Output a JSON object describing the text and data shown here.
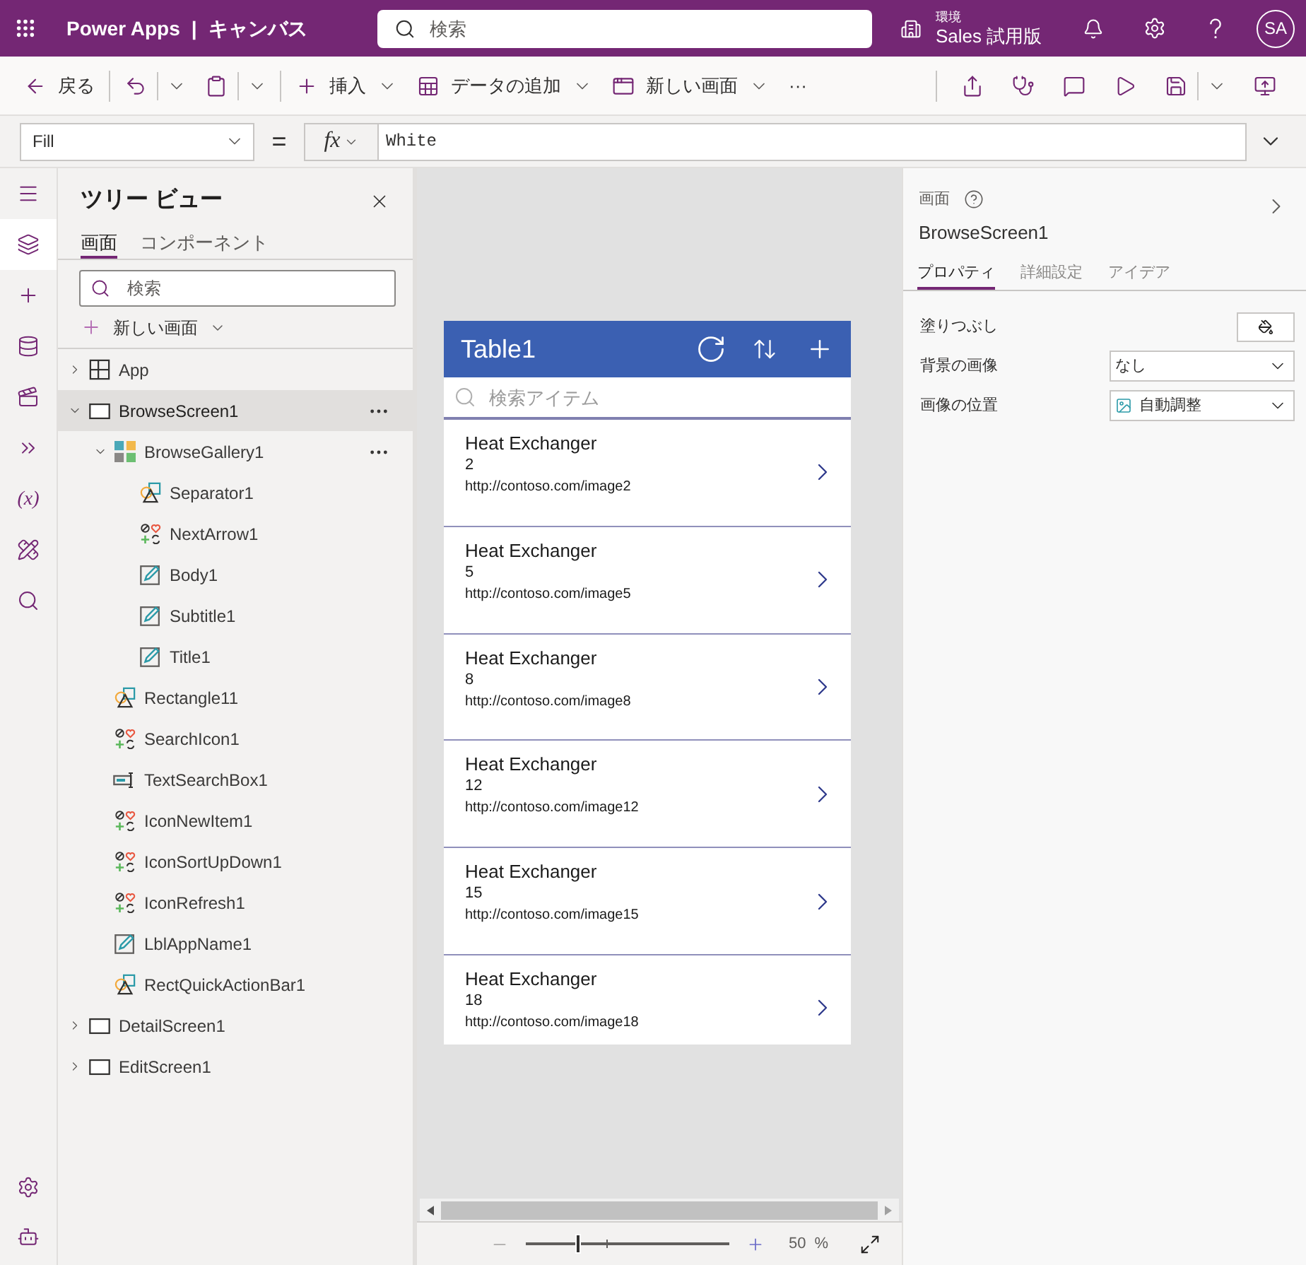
{
  "top_bar": {
    "title": "Power Apps",
    "separator": "|",
    "subtitle": "キャンバス",
    "search": {
      "placeholder": "検索"
    },
    "environment": {
      "label": "環境",
      "name": "Sales 試用版"
    },
    "avatar": "SA"
  },
  "toolbar": {
    "left": [
      [
        {
          "kind": "back",
          "label": "戻る"
        }
      ],
      [
        {
          "kind": "undo",
          "split": true
        },
        {
          "kind": "paste",
          "split": true
        }
      ],
      [
        {
          "kind": "insert",
          "label": "挿入",
          "caret": true
        },
        {
          "kind": "add_data",
          "label": "データの追加",
          "caret": true
        },
        {
          "kind": "new_screen",
          "label": "新しい画面",
          "caret": true
        },
        {
          "kind": "more",
          "label": "···"
        }
      ]
    ],
    "right": [
      {
        "kind": "share"
      },
      {
        "kind": "checker"
      },
      {
        "kind": "comments"
      },
      {
        "kind": "preview"
      },
      {
        "kind": "save",
        "split": true
      },
      {
        "kind": "publish"
      }
    ]
  },
  "formula_bar": {
    "property": "Fill",
    "operator": "=",
    "fx": "fx",
    "formula": "White"
  },
  "left_rail": {
    "items": [
      {
        "kind": "menu",
        "selected": false
      },
      {
        "kind": "tree",
        "selected": true
      },
      {
        "kind": "insert",
        "selected": false
      },
      {
        "kind": "data",
        "selected": false
      },
      {
        "kind": "media",
        "selected": false
      },
      {
        "kind": "automate",
        "selected": false
      },
      {
        "kind": "variables",
        "glyph": "(x)",
        "selected": false
      },
      {
        "kind": "tools",
        "selected": false
      },
      {
        "kind": "search",
        "selected": false
      }
    ],
    "bottom": [
      {
        "kind": "settings"
      },
      {
        "kind": "agent"
      }
    ]
  },
  "tree_view": {
    "title": "ツリー ビュー",
    "tabs": [
      {
        "label": "画面",
        "selected": true
      },
      {
        "label": "コンポーネント",
        "selected": false
      }
    ],
    "search": {
      "placeholder": "検索"
    },
    "new_screen": {
      "label": "新しい画面"
    },
    "items": [
      {
        "kind": "app",
        "label": "App",
        "expanded": false,
        "selected": false
      },
      {
        "kind": "screen",
        "label": "BrowseScreen1",
        "expanded": true,
        "selected": true,
        "more_button": true,
        "children": [
          {
            "kind": "gallery",
            "label": "BrowseGallery1",
            "expanded": true,
            "selected": false,
            "more_button": true,
            "children": [
              {
                "kind": "shape",
                "label": "Separator1",
                "selected": false
              },
              {
                "kind": "icon",
                "label": "NextArrow1",
                "selected": false
              },
              {
                "kind": "label",
                "label": "Body1",
                "selected": false
              },
              {
                "kind": "label",
                "label": "Subtitle1",
                "selected": false
              },
              {
                "kind": "label",
                "label": "Title1",
                "selected": false
              }
            ]
          },
          {
            "kind": "shape",
            "label": "Rectangle11",
            "selected": false
          },
          {
            "kind": "icon",
            "label": "SearchIcon1",
            "selected": false
          },
          {
            "kind": "textinput",
            "label": "TextSearchBox1",
            "selected": false
          },
          {
            "kind": "icon",
            "label": "IconNewItem1",
            "selected": false
          },
          {
            "kind": "icon",
            "label": "IconSortUpDown1",
            "selected": false
          },
          {
            "kind": "icon",
            "label": "IconRefresh1",
            "selected": false
          },
          {
            "kind": "label",
            "label": "LblAppName1",
            "selected": false
          },
          {
            "kind": "shape",
            "label": "RectQuickActionBar1",
            "selected": false
          }
        ]
      },
      {
        "kind": "screen",
        "label": "DetailScreen1",
        "expanded": false,
        "selected": false
      },
      {
        "kind": "screen",
        "label": "EditScreen1",
        "expanded": false,
        "selected": false
      }
    ]
  },
  "canvas": {
    "app": {
      "title": "Table1",
      "search": {
        "placeholder": "検索アイテム"
      },
      "items": [
        {
          "title": "Heat Exchanger",
          "number": "2",
          "url": "http://contoso.com/image2"
        },
        {
          "title": "Heat Exchanger",
          "number": "5",
          "url": "http://contoso.com/image5"
        },
        {
          "title": "Heat Exchanger",
          "number": "8",
          "url": "http://contoso.com/image8"
        },
        {
          "title": "Heat Exchanger",
          "number": "12",
          "url": "http://contoso.com/image12"
        },
        {
          "title": "Heat Exchanger",
          "number": "15",
          "url": "http://contoso.com/image15"
        },
        {
          "title": "Heat Exchanger",
          "number": "18",
          "url": "http://contoso.com/image18"
        }
      ]
    },
    "zoom": {
      "level": 0.26,
      "value": "50",
      "unit": "%"
    }
  },
  "properties": {
    "type_label": "画面",
    "name": "BrowseScreen1",
    "tabs": [
      {
        "label": "プロパティ",
        "selected": true
      },
      {
        "label": "詳細設定",
        "selected": false
      },
      {
        "label": "アイデア",
        "selected": false
      }
    ],
    "rows": [
      {
        "kind": "color",
        "label": "塗りつぶし"
      },
      {
        "kind": "dropdown",
        "label": "背景の画像",
        "value": "なし"
      },
      {
        "kind": "dropdown",
        "label": "画像の位置",
        "value": "自動調整",
        "with_icon": true
      }
    ]
  }
}
